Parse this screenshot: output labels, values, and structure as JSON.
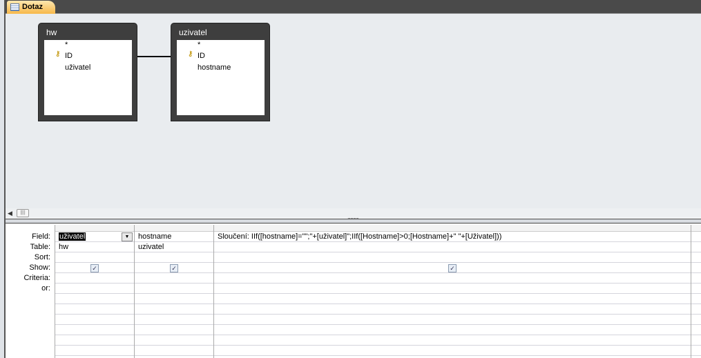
{
  "tab": {
    "label": "Dotaz"
  },
  "tables": [
    {
      "name": "hw",
      "fields": [
        "*",
        "ID",
        "uživatel"
      ],
      "key_field": "ID"
    },
    {
      "name": "uzivatel",
      "fields": [
        "*",
        "ID",
        "hostname"
      ],
      "key_field": "ID"
    }
  ],
  "grid": {
    "row_labels": [
      "Field:",
      "Table:",
      "Sort:",
      "Show:",
      "Criteria:",
      "or:"
    ],
    "columns": [
      {
        "field": "uživatel",
        "table": "hw",
        "show": true
      },
      {
        "field": "hostname",
        "table": "uzivatel",
        "show": true
      },
      {
        "field": "Sloučení: IIf([hostname]=\"\";\"+[uživatel]\";IIf([Hostname]>0;[Hostname]+\" \"+[Uživatel]))",
        "table": "",
        "show": true
      }
    ]
  }
}
